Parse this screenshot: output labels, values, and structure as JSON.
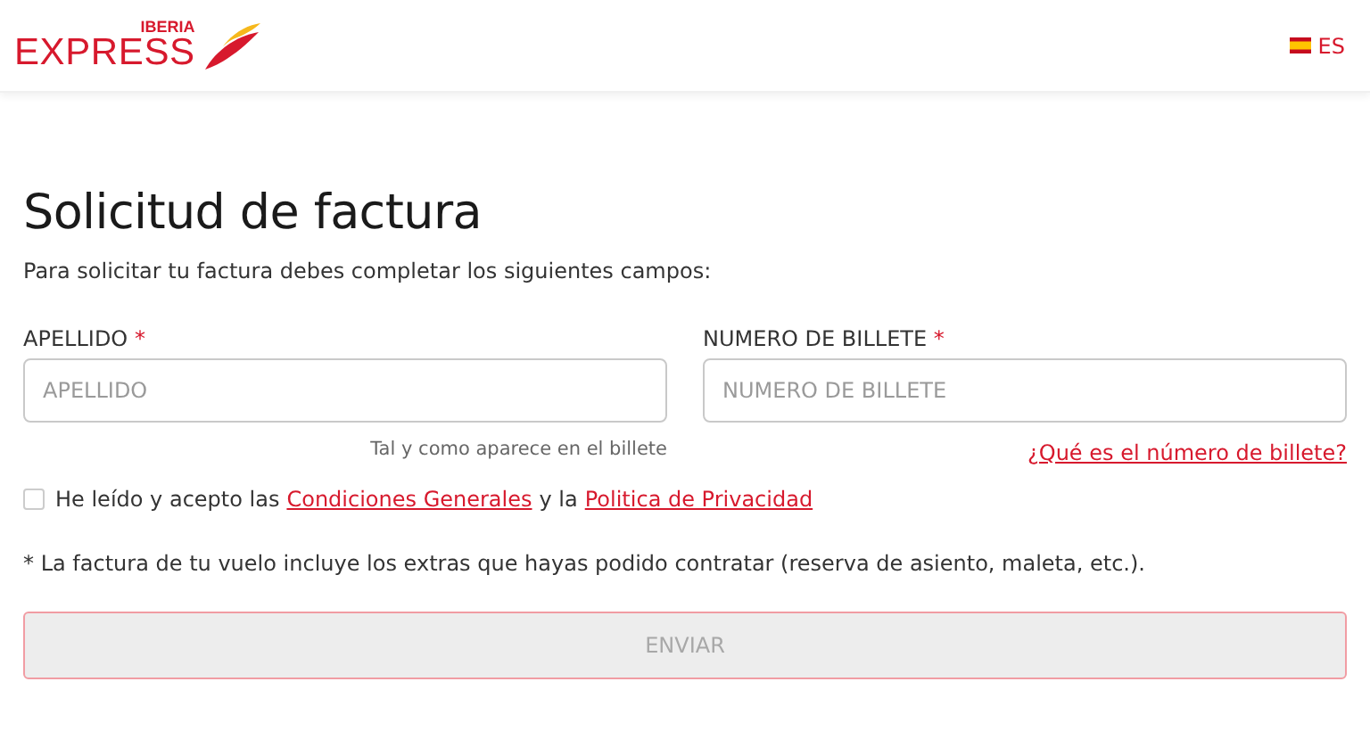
{
  "header": {
    "logo": {
      "top": "IBERIA",
      "main": "EXPRESS"
    },
    "language": "ES"
  },
  "title": "Solicitud de factura",
  "intro": "Para solicitar tu factura debes completar los siguientes campos:",
  "fields": [
    {
      "label": "APELLIDO",
      "required_mark": "*",
      "placeholder": "APELLIDO",
      "help": "Tal y como aparece en el billete",
      "kind": "text"
    },
    {
      "label": "NUMERO DE BILLETE",
      "required_mark": "*",
      "placeholder": "NUMERO DE BILLETE",
      "help": "¿Qué es el número de billete?",
      "kind": "link"
    }
  ],
  "consent": {
    "checked": false,
    "parts": [
      {
        "kind": "text",
        "text": "He leído y acepto las"
      },
      {
        "kind": "link",
        "text": "Condiciones Generales"
      },
      {
        "kind": "text",
        "text": "y la"
      },
      {
        "kind": "link",
        "text": "Politica de Privacidad"
      }
    ]
  },
  "note": "* La factura de tu vuelo incluye los extras que hayas podido contratar (reserva de asiento, maleta, etc.).",
  "submit": {
    "label": "ENVIAR",
    "disabled": true
  }
}
